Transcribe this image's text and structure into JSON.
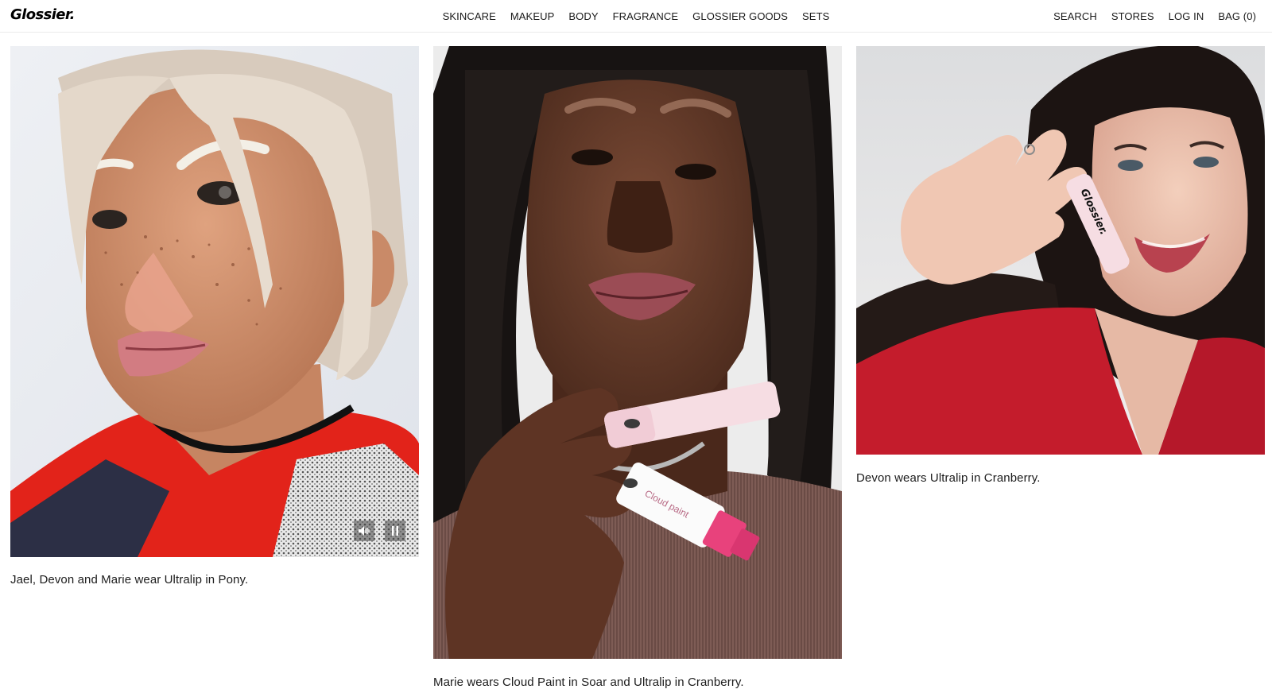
{
  "brand": {
    "logo_text": "Glossier."
  },
  "nav": {
    "center": [
      "SKINCARE",
      "MAKEUP",
      "BODY",
      "FRAGRANCE",
      "GLOSSIER GOODS",
      "SETS"
    ],
    "right": [
      "SEARCH",
      "STORES",
      "LOG IN",
      "BAG (0)"
    ]
  },
  "gallery": [
    {
      "caption": "Jael, Devon and Marie wear Ultralip in Pony.",
      "media": "video",
      "controls": [
        "volume-icon",
        "pause-icon"
      ]
    },
    {
      "caption": "Marie wears Cloud Paint in Soar and Ultralip in Cranberry.",
      "media": "image",
      "product_labels": [
        "Cloud paint"
      ]
    },
    {
      "caption": "Devon wears Ultralip in Cranberry.",
      "media": "image",
      "product_labels": [
        "Glossier."
      ]
    }
  ],
  "colors": {
    "accent_pink": "#e8427c",
    "product_pink": "#f6dde3",
    "red_garment": "#c41c2c",
    "nav_border": "#ececec"
  }
}
